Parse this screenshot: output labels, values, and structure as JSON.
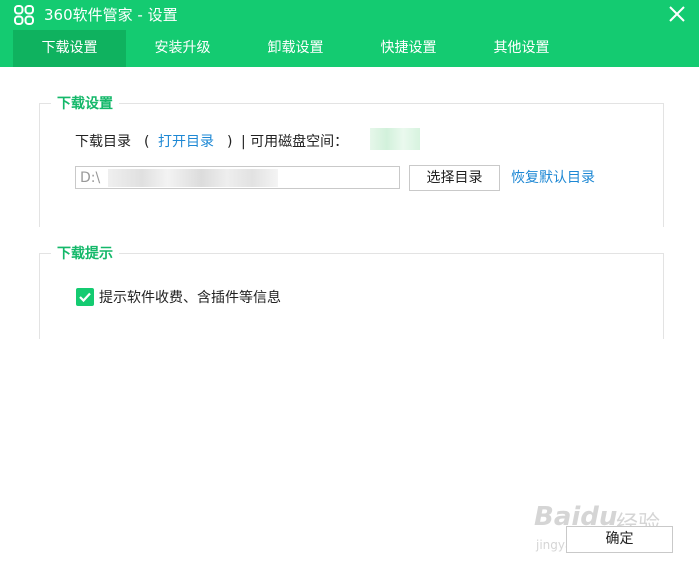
{
  "window": {
    "title": "360软件管家 - 设置",
    "accent_color": "#14cb71",
    "icons": [
      "app-logo-icon",
      "close-icon",
      "checkmark-icon"
    ]
  },
  "tabs": [
    {
      "label": "下载设置",
      "active": true
    },
    {
      "label": "安装升级",
      "active": false
    },
    {
      "label": "卸载设置",
      "active": false
    },
    {
      "label": "快捷设置",
      "active": false
    },
    {
      "label": "其他设置",
      "active": false
    }
  ],
  "download_settings": {
    "section_title": "下载设置",
    "dir_label": "下载目录",
    "open_paren": "(",
    "open_dir_link": "打开目录",
    "close_paren": ")",
    "space_label": "| 可用磁盘空间：",
    "path_value": "D:\\",
    "select_dir_button": "选择目录",
    "restore_default_link": "恢复默认目录"
  },
  "download_tips": {
    "section_title": "下载提示",
    "checkbox_label": "提示软件收费、含插件等信息",
    "checked": true
  },
  "footer": {
    "ok_button": "确定"
  },
  "watermark": {
    "brand": "Baidu",
    "suffix": "经验",
    "url": "jingyan.baidu.com"
  }
}
